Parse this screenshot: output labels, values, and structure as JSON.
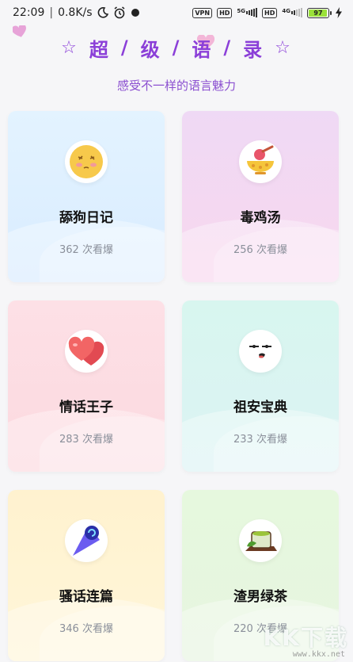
{
  "status_bar": {
    "time": "22:09",
    "net_speed": "0.8K/s",
    "vpn": "VPN",
    "hd1": "HD",
    "net1": "5G",
    "hd2": "HD",
    "net2": "4G",
    "battery": "97"
  },
  "header": {
    "title_chars": [
      "超",
      "级",
      "语",
      "录"
    ],
    "separator": "/",
    "star": "☆",
    "subtitle": "感受不一样的语言魅力"
  },
  "cards": [
    {
      "name": "舔狗日记",
      "count": "362 次看爆",
      "icon": "blushing-face-icon"
    },
    {
      "name": "毒鸡汤",
      "count": "256 次看爆",
      "icon": "soup-bowl-icon"
    },
    {
      "name": "情话王子",
      "count": "283 次看爆",
      "icon": "hearts-icon"
    },
    {
      "name": "祖安宝典",
      "count": "233 次看爆",
      "icon": "smirk-face-icon"
    },
    {
      "name": "骚话连篇",
      "count": "346 次看爆",
      "icon": "cone-icon"
    },
    {
      "name": "渣男绿茶",
      "count": "220 次看爆",
      "icon": "green-tea-icon"
    }
  ],
  "watermark": {
    "text": "KK下载",
    "url": "www.kkx.net"
  },
  "colors": {
    "accent": "#8b3fd8"
  }
}
